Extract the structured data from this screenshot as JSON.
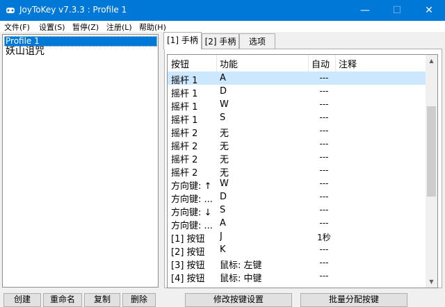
{
  "window": {
    "title": "JoyToKey v7.3.3 : Profile 1",
    "minimize": "—",
    "maximize": "☐",
    "close": "✕"
  },
  "menu": [
    "文件(F)",
    "设置(S)",
    "暂停(Z)",
    "注册(L)",
    "帮助(H)"
  ],
  "profiles": [
    {
      "label": "Profile 1",
      "selected": true
    },
    {
      "label": "妖山诅咒",
      "selected": false
    }
  ],
  "tabs": [
    "[1] 手柄",
    "[2] 手柄",
    "选项"
  ],
  "table": {
    "headers": [
      "按钮",
      "功能",
      "自动",
      "注释"
    ],
    "rows": [
      {
        "button": "摇杆 1",
        "func": "A",
        "auto": "---"
      },
      {
        "button": "摇杆 1",
        "func": "D",
        "auto": "---"
      },
      {
        "button": "摇杆 1",
        "func": "W",
        "auto": "---"
      },
      {
        "button": "摇杆 1",
        "func": "S",
        "auto": "---"
      },
      {
        "button": "摇杆 2",
        "func": "无",
        "auto": "---"
      },
      {
        "button": "摇杆 2",
        "func": "无",
        "auto": "---"
      },
      {
        "button": "摇杆 2",
        "func": "无",
        "auto": "---"
      },
      {
        "button": "摇杆 2",
        "func": "无",
        "auto": "---"
      },
      {
        "button": "方向键: ↑",
        "func": "W",
        "auto": "---"
      },
      {
        "button": "方向键: ...",
        "func": "D",
        "auto": "---"
      },
      {
        "button": "方向键: ↓",
        "func": "S",
        "auto": "---"
      },
      {
        "button": "方向键: ...",
        "func": "A",
        "auto": "---"
      },
      {
        "button": "[1] 按钮",
        "func": "J",
        "auto": "1秒"
      },
      {
        "button": "[2] 按钮",
        "func": "K",
        "auto": "---"
      },
      {
        "button": "[3] 按钮",
        "func": "鼠标: 左键",
        "auto": "---"
      },
      {
        "button": "[4] 按钮",
        "func": "鼠标: 中键",
        "auto": "---"
      }
    ]
  },
  "left_buttons": [
    "创建",
    "重命名",
    "复制",
    "删除"
  ],
  "right_buttons": [
    "修改按键设置",
    "批量分配按键"
  ]
}
